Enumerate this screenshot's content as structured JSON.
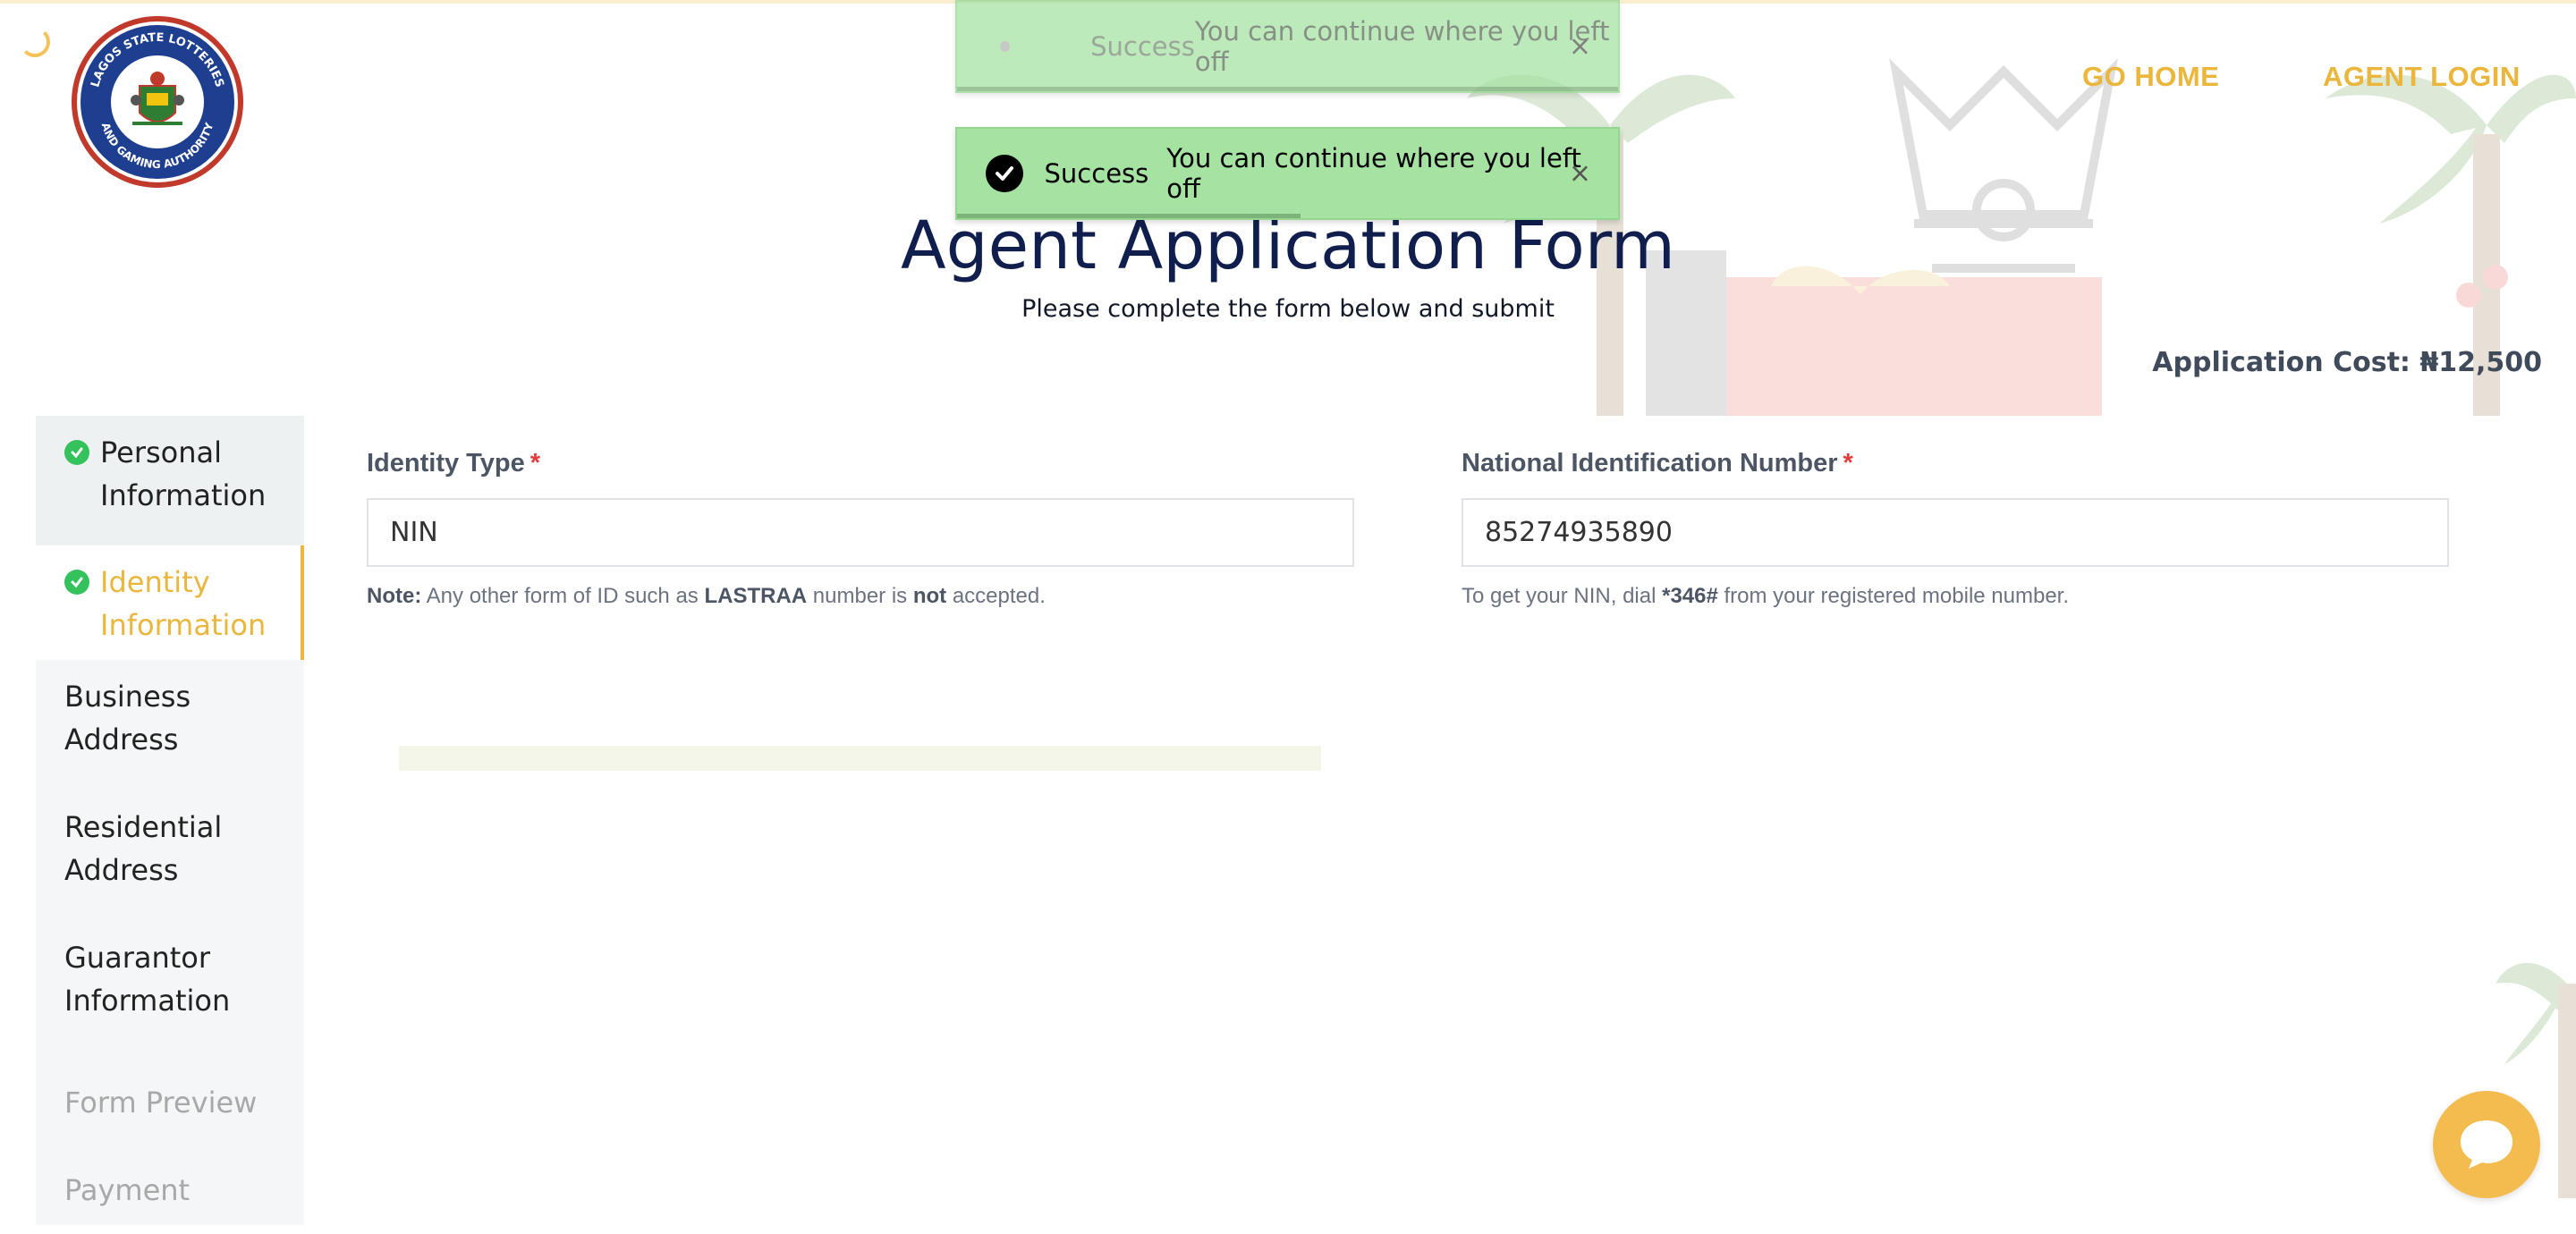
{
  "header": {
    "nav": {
      "go_home": "GO HOME",
      "agent_login": "AGENT LOGIN"
    },
    "logo": {
      "top_text": "LAGOS STATE LOTTERIES",
      "bottom_text": "AND GAMING AUTHORITY"
    }
  },
  "toasts": [
    {
      "title": "Success",
      "message": "You can continue where you left off",
      "close": "×"
    },
    {
      "title": "Success",
      "message": "You can continue where you left off",
      "close": "×"
    }
  ],
  "page": {
    "title": "Agent Application Form",
    "subtitle": "Please complete the form below and submit",
    "cost": "Application Cost: ₦12,500"
  },
  "sidebar": {
    "items": [
      {
        "label": "Personal Information",
        "state": "completed"
      },
      {
        "label": "Identity Information",
        "state": "active-completed"
      },
      {
        "label": "Business Address",
        "state": "pending"
      },
      {
        "label": "Residential Address",
        "state": "pending"
      },
      {
        "label": "Guarantor Information",
        "state": "pending"
      },
      {
        "label": "Form Preview",
        "state": "disabled"
      },
      {
        "label": "Payment",
        "state": "disabled"
      }
    ]
  },
  "form": {
    "identity_type": {
      "label": "Identity Type",
      "required_mark": "*",
      "value": "NIN",
      "note_prefix": "Note:",
      "note_part1": "Any other form of ID such as",
      "note_bold1": "LASTRAA",
      "note_part2": "number is",
      "note_bold2": "not",
      "note_part3": "accepted."
    },
    "nin": {
      "label": "National Identification Number",
      "required_mark": "*",
      "value": "85274935890",
      "hint_part1": "To get your NIN, dial",
      "hint_bold": "*346#",
      "hint_part2": "from your registered mobile number."
    }
  },
  "colors": {
    "accent": "#eab63c",
    "title": "#0f1e4d",
    "toast_bg": "#a6e3a3",
    "success_check": "#34c25c",
    "required": "#e23b3b"
  },
  "icons": {
    "spinner": "loading-spinner-icon",
    "check": "check-circle-icon",
    "close": "close-icon",
    "chat": "chat-bubble-icon"
  }
}
